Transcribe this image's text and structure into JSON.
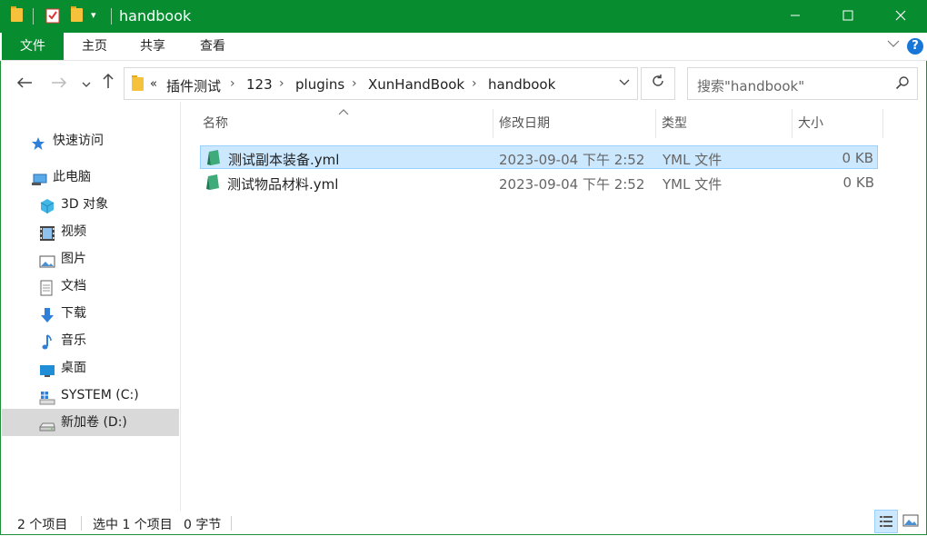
{
  "window": {
    "title": "handbook"
  },
  "ribbon": {
    "tabs": [
      "文件",
      "主页",
      "共享",
      "查看"
    ]
  },
  "address": {
    "overflow": "«",
    "crumbs": [
      "插件测试",
      "123",
      "plugins",
      "XunHandBook",
      "handbook"
    ]
  },
  "search": {
    "placeholder": "搜索\"handbook\""
  },
  "nav": {
    "quick_access": "快速访问",
    "this_pc": "此电脑",
    "items": [
      "3D 对象",
      "视频",
      "图片",
      "文档",
      "下载",
      "音乐",
      "桌面",
      "SYSTEM (C:)",
      "新加卷 (D:)"
    ]
  },
  "columns": {
    "name": "名称",
    "date": "修改日期",
    "type": "类型",
    "size": "大小"
  },
  "files": [
    {
      "name": "测试副本装备.yml",
      "date": "2023-09-04 下午 2:52",
      "type": "YML 文件",
      "size": "0 KB",
      "selected": true
    },
    {
      "name": "测试物品材料.yml",
      "date": "2023-09-04 下午 2:52",
      "type": "YML 文件",
      "size": "0 KB",
      "selected": false
    }
  ],
  "status": {
    "count": "2 个项目",
    "selected": "选中 1 个项目",
    "size": "0 字节"
  },
  "colors": {
    "titlebar": "#078c2f",
    "selection": "#cce8ff",
    "selection_border": "#99d1ff"
  }
}
